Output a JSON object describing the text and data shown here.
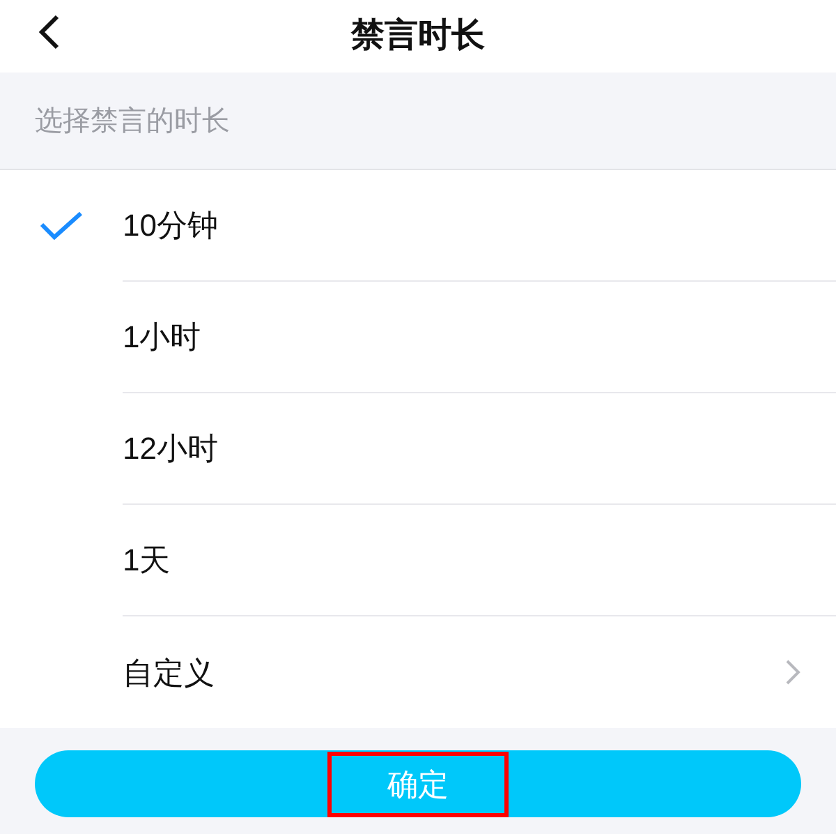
{
  "header": {
    "title": "禁言时长"
  },
  "section": {
    "label": "选择禁言的时长"
  },
  "options": [
    {
      "label": "10分钟",
      "selected": true,
      "kind": "option"
    },
    {
      "label": "1小时",
      "selected": false,
      "kind": "option"
    },
    {
      "label": "12小时",
      "selected": false,
      "kind": "option"
    },
    {
      "label": "1天",
      "selected": false,
      "kind": "option"
    },
    {
      "label": "自定义",
      "selected": false,
      "kind": "link"
    }
  ],
  "confirm_button": {
    "label": "确定",
    "highlighted": true
  }
}
